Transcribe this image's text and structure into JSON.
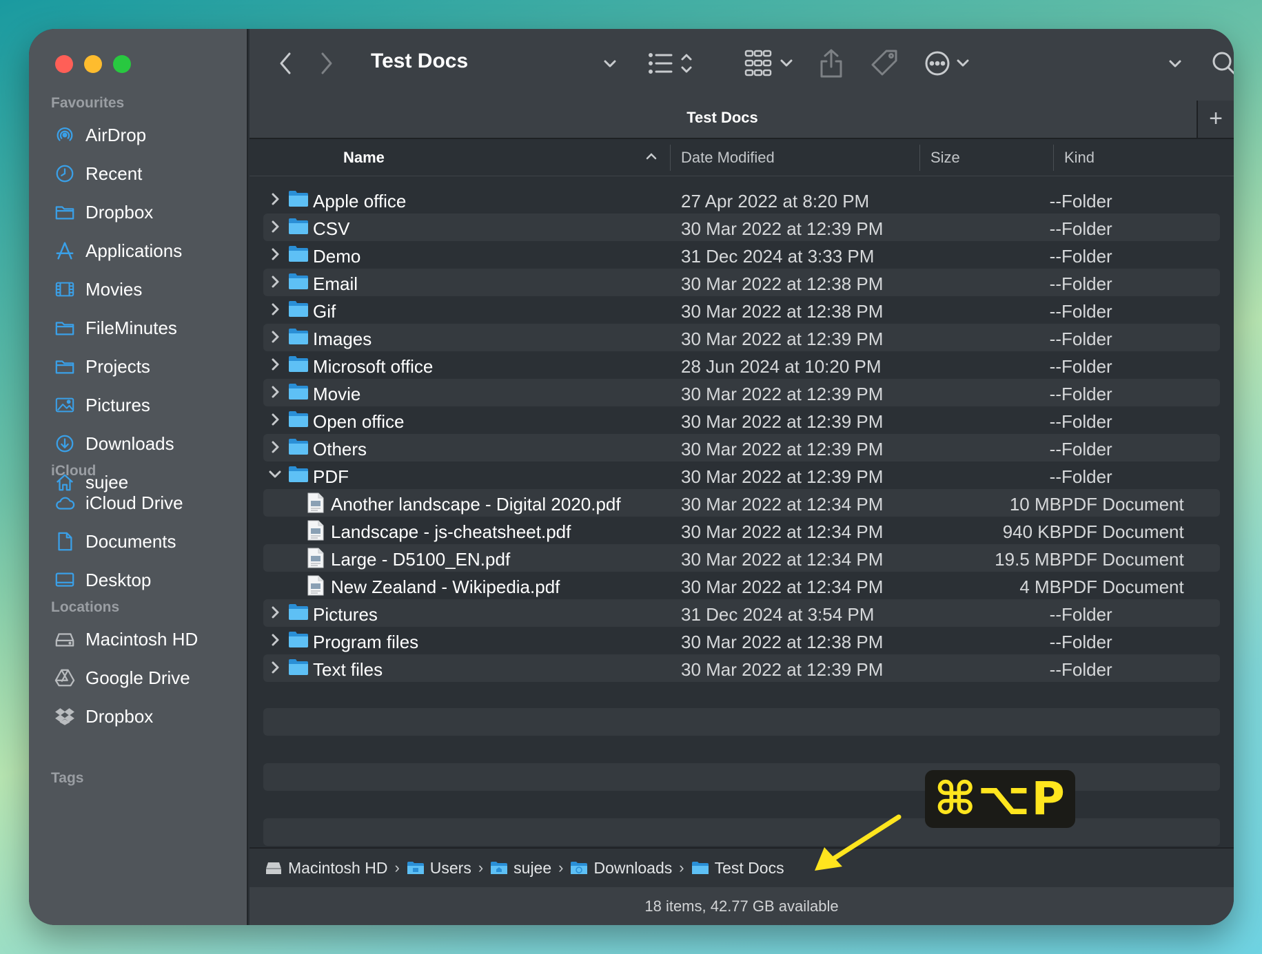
{
  "window": {
    "title": "Test Docs"
  },
  "sidebar": {
    "favourites_heading": "Favourites",
    "favourites": [
      {
        "label": "AirDrop",
        "icon": "airdrop-icon"
      },
      {
        "label": "Recent",
        "icon": "clock-icon"
      },
      {
        "label": "Dropbox",
        "icon": "folder-icon"
      },
      {
        "label": "Applications",
        "icon": "applications-icon"
      },
      {
        "label": "Movies",
        "icon": "film-icon"
      },
      {
        "label": "FileMinutes",
        "icon": "folder-icon"
      },
      {
        "label": "Projects",
        "icon": "folder-icon"
      },
      {
        "label": "Pictures",
        "icon": "photo-icon"
      },
      {
        "label": "Downloads",
        "icon": "download-icon"
      },
      {
        "label": "sujee",
        "icon": "home-icon"
      }
    ],
    "icloud_heading": "iCloud",
    "icloud": [
      {
        "label": "iCloud Drive",
        "icon": "cloud-icon"
      },
      {
        "label": "Documents",
        "icon": "document-icon"
      },
      {
        "label": "Desktop",
        "icon": "desktop-icon"
      }
    ],
    "locations_heading": "Locations",
    "locations": [
      {
        "label": "Macintosh HD",
        "icon": "drive-icon"
      },
      {
        "label": "Google Drive",
        "icon": "google-drive-icon"
      },
      {
        "label": "Dropbox",
        "icon": "dropbox-icon"
      }
    ],
    "tags_heading": "Tags"
  },
  "tab": {
    "title": "Test Docs",
    "add_label": "+"
  },
  "columns": {
    "name": "Name",
    "date": "Date Modified",
    "size": "Size",
    "kind": "Kind"
  },
  "files": [
    {
      "name": "Apple office",
      "date": "27 Apr 2022 at 8:20 PM",
      "size": "--",
      "kind": "Folder",
      "type": "folder"
    },
    {
      "name": "CSV",
      "date": "30 Mar 2022 at 12:39 PM",
      "size": "--",
      "kind": "Folder",
      "type": "folder"
    },
    {
      "name": "Demo",
      "date": "31 Dec 2024 at 3:33 PM",
      "size": "--",
      "kind": "Folder",
      "type": "folder"
    },
    {
      "name": "Email",
      "date": "30 Mar 2022 at 12:38 PM",
      "size": "--",
      "kind": "Folder",
      "type": "folder"
    },
    {
      "name": "Gif",
      "date": "30 Mar 2022 at 12:38 PM",
      "size": "--",
      "kind": "Folder",
      "type": "folder"
    },
    {
      "name": "Images",
      "date": "30 Mar 2022 at 12:39 PM",
      "size": "--",
      "kind": "Folder",
      "type": "folder"
    },
    {
      "name": "Microsoft office",
      "date": "28 Jun 2024 at 10:20 PM",
      "size": "--",
      "kind": "Folder",
      "type": "folder"
    },
    {
      "name": "Movie",
      "date": "30 Mar 2022 at 12:39 PM",
      "size": "--",
      "kind": "Folder",
      "type": "folder"
    },
    {
      "name": "Open office",
      "date": "30 Mar 2022 at 12:39 PM",
      "size": "--",
      "kind": "Folder",
      "type": "folder"
    },
    {
      "name": "Others",
      "date": "30 Mar 2022 at 12:39 PM",
      "size": "--",
      "kind": "Folder",
      "type": "folder"
    },
    {
      "name": "PDF",
      "date": "30 Mar 2022 at 12:39 PM",
      "size": "--",
      "kind": "Folder",
      "type": "folder-open"
    },
    {
      "name": "Another landscape - Digital 2020.pdf",
      "date": "30 Mar 2022 at 12:34 PM",
      "size": "10 MB",
      "kind": "PDF Document",
      "type": "pdf"
    },
    {
      "name": "Landscape - js-cheatsheet.pdf",
      "date": "30 Mar 2022 at 12:34 PM",
      "size": "940 KB",
      "kind": "PDF Document",
      "type": "pdf"
    },
    {
      "name": "Large - D5100_EN.pdf",
      "date": "30 Mar 2022 at 12:34 PM",
      "size": "19.5 MB",
      "kind": "PDF Document",
      "type": "pdf"
    },
    {
      "name": "New Zealand - Wikipedia.pdf",
      "date": "30 Mar 2022 at 12:34 PM",
      "size": "4 MB",
      "kind": "PDF Document",
      "type": "pdf"
    },
    {
      "name": "Pictures",
      "date": "31 Dec 2024 at 3:54 PM",
      "size": "--",
      "kind": "Folder",
      "type": "folder"
    },
    {
      "name": "Program files",
      "date": "30 Mar 2022 at 12:38 PM",
      "size": "--",
      "kind": "Folder",
      "type": "folder"
    },
    {
      "name": "Text files",
      "date": "30 Mar 2022 at 12:39 PM",
      "size": "--",
      "kind": "Folder",
      "type": "folder"
    }
  ],
  "pathbar": [
    "Macintosh HD",
    "Users",
    "sujee",
    "Downloads",
    "Test Docs"
  ],
  "status": "18 items, 42.77 GB available",
  "shortcut_overlay": "⌘⌥P",
  "colors": {
    "accent": "#3aa0e8",
    "folder": "#4fb3f0",
    "highlight": "#ffe51e"
  }
}
